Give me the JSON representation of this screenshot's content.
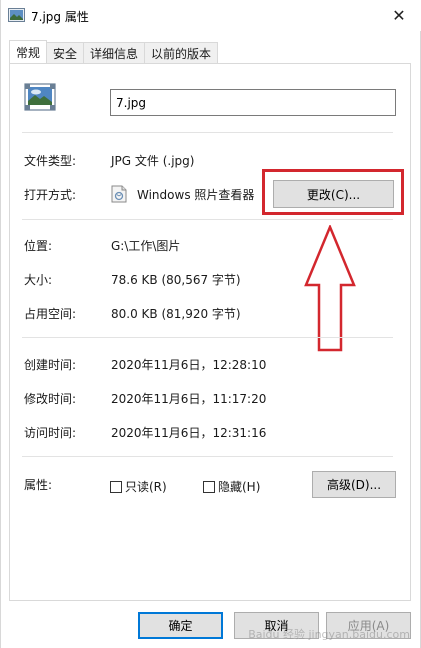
{
  "window": {
    "title": "7.jpg 属性",
    "close_glyph": "✕"
  },
  "tabs": [
    {
      "label": "常规",
      "active": true
    },
    {
      "label": "安全",
      "active": false
    },
    {
      "label": "详细信息",
      "active": false
    },
    {
      "label": "以前的版本",
      "active": false
    }
  ],
  "general": {
    "filename": "7.jpg",
    "file_type_label": "文件类型:",
    "file_type_value": "JPG 文件 (.jpg)",
    "open_with_label": "打开方式:",
    "open_with_app": "Windows 照片查看器",
    "change_button": "更改(C)...",
    "location_label": "位置:",
    "location_value": "G:\\工作\\图片",
    "size_label": "大小:",
    "size_value": "78.6 KB (80,567 字节)",
    "size_on_disk_label": "占用空间:",
    "size_on_disk_value": "80.0 KB (81,920 字节)",
    "created_label": "创建时间:",
    "created_value": "2020年11月6日，12:28:10",
    "modified_label": "修改时间:",
    "modified_value": "2020年11月6日，11:17:20",
    "accessed_label": "访问时间:",
    "accessed_value": "2020年11月6日，12:31:16",
    "attributes_label": "属性:",
    "readonly_label": "只读(R)",
    "hidden_label": "隐藏(H)",
    "advanced_button": "高级(D)..."
  },
  "footer": {
    "ok_button": "确定",
    "cancel_button": "取消",
    "apply_button": "应用(A)"
  },
  "annotations": {
    "highlight_color": "#d3272e"
  },
  "watermark": "Baidu 经验  jingyan.baidu.com"
}
